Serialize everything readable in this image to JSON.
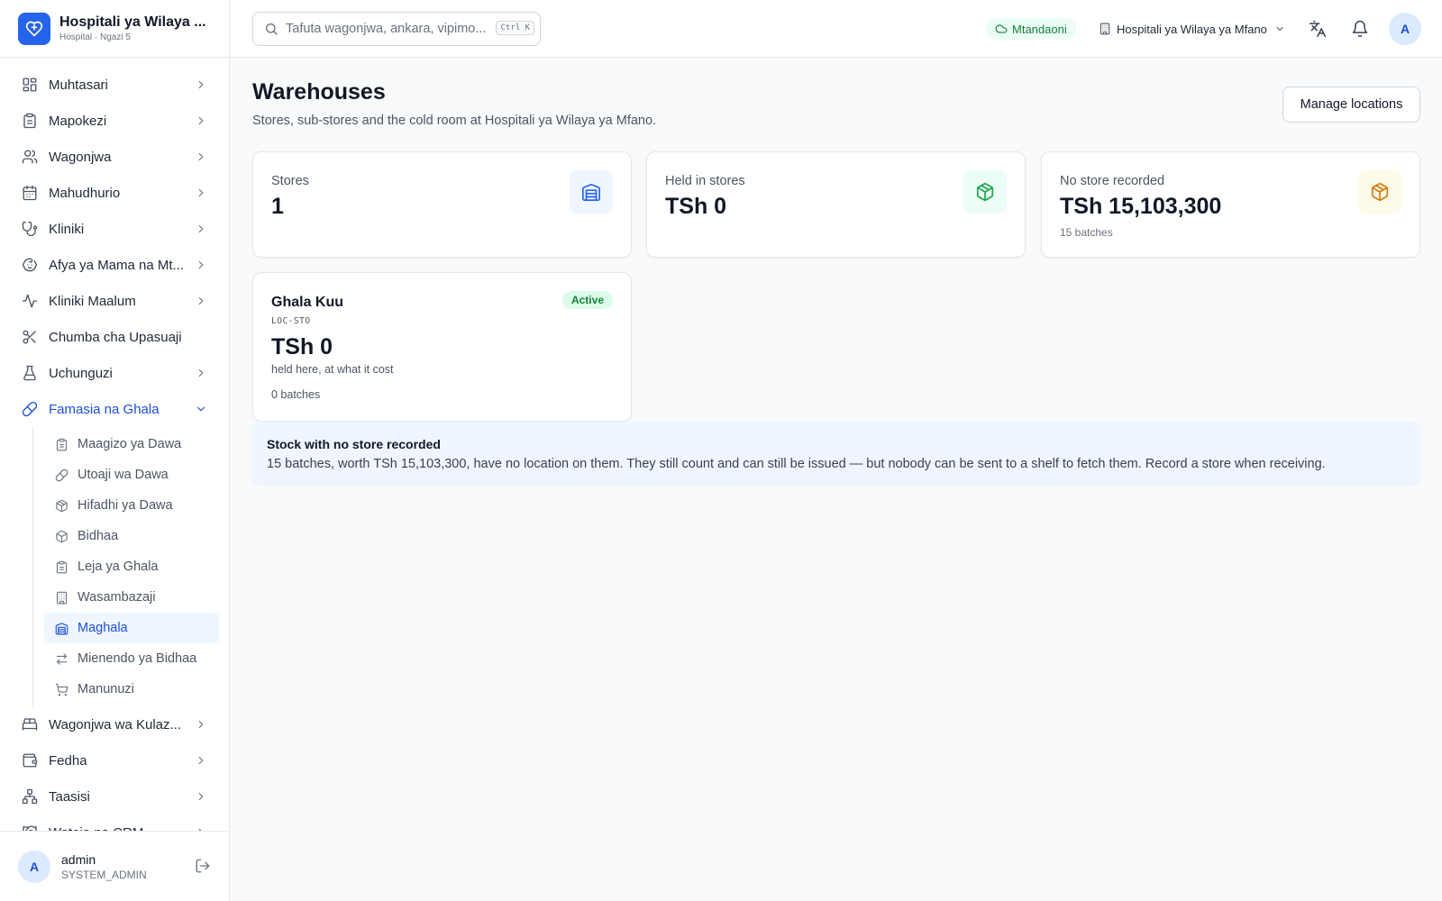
{
  "brand": {
    "title": "Hospitali ya Wilaya ...",
    "subtitle": "Hospital · Ngazi 5"
  },
  "sidebar": {
    "items": [
      {
        "label": "Muhtasari",
        "icon": "grid-icon"
      },
      {
        "label": "Mapokezi",
        "icon": "clipboard-icon"
      },
      {
        "label": "Wagonjwa",
        "icon": "users-icon"
      },
      {
        "label": "Mahudhurio",
        "icon": "calendar-icon"
      },
      {
        "label": "Kliniki",
        "icon": "stethoscope-icon"
      },
      {
        "label": "Afya ya Mama na Mt...",
        "icon": "baby-icon"
      },
      {
        "label": "Kliniki Maalum",
        "icon": "activity-icon"
      },
      {
        "label": "Chumba cha Upasuaji",
        "icon": "scissors-icon"
      },
      {
        "label": "Uchunguzi",
        "icon": "flask-icon"
      },
      {
        "label": "Famasia na Ghala",
        "icon": "pill-icon",
        "expanded": true
      }
    ],
    "subitems": [
      {
        "label": "Maagizo ya Dawa",
        "icon": "clipboard-icon"
      },
      {
        "label": "Utoaji wa Dawa",
        "icon": "pill-icon"
      },
      {
        "label": "Hifadhi ya Dawa",
        "icon": "package-icon"
      },
      {
        "label": "Bidhaa",
        "icon": "package-icon"
      },
      {
        "label": "Leja ya Ghala",
        "icon": "clipboard-icon"
      },
      {
        "label": "Wasambazaji",
        "icon": "building-icon"
      },
      {
        "label": "Maghala",
        "icon": "warehouse-icon",
        "active": true
      },
      {
        "label": "Mienendo ya Bidhaa",
        "icon": "arrows-icon"
      },
      {
        "label": "Manunuzi",
        "icon": "cart-icon"
      }
    ],
    "items_after": [
      {
        "label": "Wagonjwa wa Kulaz...",
        "icon": "bed-icon"
      },
      {
        "label": "Fedha",
        "icon": "wallet-icon"
      },
      {
        "label": "Taasisi",
        "icon": "network-icon"
      },
      {
        "label": "Wateja na CRM",
        "icon": "handshake-icon"
      }
    ]
  },
  "user": {
    "initial": "A",
    "name": "admin",
    "role": "SYSTEM_ADMIN"
  },
  "topbar": {
    "search_placeholder": "Tafuta wagonjwa, ankara, vipimo...",
    "shortcut": "Ctrl K",
    "status": "Mtandaoni",
    "facility": "Hospitali ya Wilaya ya Mfano",
    "avatar_initial": "A"
  },
  "page": {
    "title": "Warehouses",
    "subtitle": "Stores, sub-stores and the cold room at Hospitali ya Wilaya ya Mfano.",
    "manage_button": "Manage locations"
  },
  "stats": [
    {
      "label": "Stores",
      "value": "1",
      "note": "",
      "icon": "warehouse-icon",
      "color": "#2563eb",
      "bg": "#eff6ff"
    },
    {
      "label": "Held in stores",
      "value": "TSh 0",
      "note": "",
      "icon": "package-icon",
      "color": "#16a34a",
      "bg": "#ecfdf5"
    },
    {
      "label": "No store recorded",
      "value": "TSh 15,103,300",
      "note": "15 batches",
      "icon": "package-icon",
      "color": "#d97706",
      "bg": "#fffbeb"
    }
  ],
  "warehouse": {
    "name": "Ghala Kuu",
    "code": "LOC-STO",
    "status": "Active",
    "value": "TSh 0",
    "caption": "held here, at what it cost",
    "batches": "0 batches"
  },
  "notice": {
    "title": "Stock with no store recorded",
    "body": "15 batches, worth TSh 15,103,300, have no location on them. They still count and can still be issued — but nobody can be sent to a shelf to fetch them. Record a store when receiving."
  }
}
